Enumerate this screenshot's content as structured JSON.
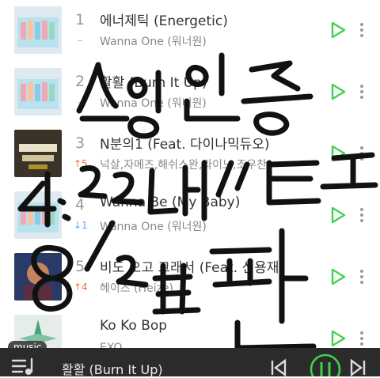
{
  "songs": [
    {
      "rank": "1",
      "change": "–",
      "change_dir": "same",
      "title": "에너제틱 (Energetic)",
      "artist": "Wanna One (워너원)",
      "cover": "#dfeaf0"
    },
    {
      "rank": "2",
      "change": "–",
      "change_dir": "same",
      "title": "활활 (Burn It Up)",
      "artist": "Wanna One (워너원)",
      "cover": "#dfeaf0"
    },
    {
      "rank": "3",
      "change": "↑5",
      "change_dir": "up",
      "title": "N분의1 (Feat. 다이나믹듀오)",
      "artist": "넉살,자메즈,해쉬스완,라이노,조우찬",
      "cover": "#3a3328"
    },
    {
      "rank": "4",
      "change": "↓1",
      "change_dir": "down",
      "title": "Wanna Be (My Baby)",
      "artist": "Wanna One (워너원)",
      "cover": "#dfeaf0"
    },
    {
      "rank": "5",
      "change": "↑4",
      "change_dir": "up",
      "title": "비도 오고 그래서 (Feat. 신용재)",
      "artist": "헤이즈 (Heize)",
      "cover": "#2a3a66"
    },
    {
      "rank": "",
      "change": "",
      "change_dir": "same",
      "title": "Ko Ko Bop",
      "artist": "EXO",
      "cover": "#e6ecea"
    }
  ],
  "player": {
    "badge": "music",
    "now_playing": "활활 (Burn It Up)"
  },
  "overlay_text": [
    "스밍인증",
    "4:22데이트",
    "8/27판"
  ],
  "colors": {
    "accent": "#3fd24a",
    "up": "#ff6a3d",
    "down": "#5aa7ff",
    "player_bg": "#2b2b2b"
  }
}
